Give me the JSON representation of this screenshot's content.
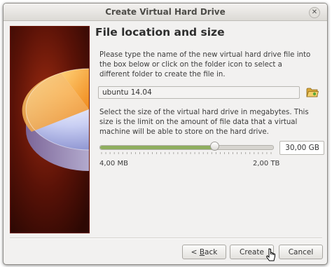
{
  "window": {
    "title": "Create Virtual Hard Drive",
    "close_glyph": "✕"
  },
  "page": {
    "heading": "File location and size",
    "location_description": "Please type the name of the new virtual hard drive file into the box below or click on the folder icon to select a different folder to create the file in.",
    "size_description": "Select the size of the virtual hard drive in megabytes. This size is the limit on the amount of file data that a virtual machine will be able to store on the hard drive."
  },
  "file_location": {
    "value": "ubuntu 14.04",
    "folder_icon": "folder-icon"
  },
  "size": {
    "value": "30,00 GB",
    "slider_fraction": 0.665,
    "min_label": "4,00 MB",
    "max_label": "2,00 TB"
  },
  "buttons": {
    "back": "< Back",
    "back_mnemonic": "B",
    "create": "Create",
    "cancel": "Cancel"
  },
  "colors": {
    "slider_fill": "#8fae5f",
    "side_image_background": "#5a1207"
  }
}
